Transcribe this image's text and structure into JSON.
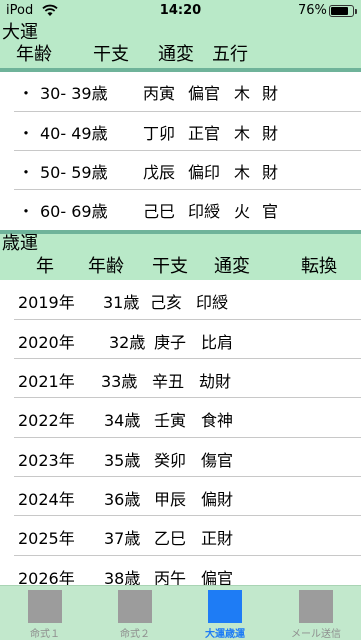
{
  "status_bar": {
    "carrier": "iPod",
    "time": "14:20",
    "battery": "76%",
    "battery_level": 0.76
  },
  "daiun": {
    "title": "大運",
    "headers": {
      "age": "年齢",
      "kanshi": "干支",
      "tsuhen": "通変",
      "gogyo": "五行"
    },
    "rows": [
      {
        "bullet": "・",
        "age": "30- 39歳",
        "kanshi": "丙寅",
        "tsuhen": "偏官",
        "gogyo": "木",
        "extra": "財"
      },
      {
        "bullet": "・",
        "age": "40- 49歳",
        "kanshi": "丁卯",
        "tsuhen": "正官",
        "gogyo": "木",
        "extra": "財"
      },
      {
        "bullet": "・",
        "age": "50- 59歳",
        "kanshi": "戊辰",
        "tsuhen": "偏印",
        "gogyo": "木",
        "extra": "財"
      },
      {
        "bullet": "・",
        "age": "60- 69歳",
        "kanshi": "己巳",
        "tsuhen": "印綬",
        "gogyo": "火",
        "extra": "官"
      }
    ]
  },
  "saiun": {
    "title": "歳運",
    "headers": {
      "year": "年",
      "age": "年齢",
      "kanshi": "干支",
      "tsuhen": "通変",
      "tenkan": "転換"
    },
    "rows": [
      {
        "year": "2019年",
        "age": "31歳",
        "kanshi": "己亥",
        "tsuhen": "印綬"
      },
      {
        "year": "2020年",
        "age": "32歳",
        "kanshi": "庚子",
        "tsuhen": "比肩"
      },
      {
        "year": "2021年",
        "age": "33歳",
        "kanshi": "辛丑",
        "tsuhen": "劫財"
      },
      {
        "year": "2022年",
        "age": "34歳",
        "kanshi": "壬寅",
        "tsuhen": "食神"
      },
      {
        "year": "2023年",
        "age": "35歳",
        "kanshi": "癸卯",
        "tsuhen": "傷官"
      },
      {
        "year": "2024年",
        "age": "36歳",
        "kanshi": "甲辰",
        "tsuhen": "偏財"
      },
      {
        "year": "2025年",
        "age": "37歳",
        "kanshi": "乙巳",
        "tsuhen": "正財"
      },
      {
        "year": "2026年",
        "age": "38歳",
        "kanshi": "丙午",
        "tsuhen": "偏官"
      }
    ]
  },
  "tabs": [
    {
      "label": "命式１",
      "active": false
    },
    {
      "label": "命式２",
      "active": false
    },
    {
      "label": "大運歳運",
      "active": true
    },
    {
      "label": "メール送信",
      "active": false
    }
  ],
  "colors": {
    "header_bg": "#b9e9c8",
    "header_bar": "#6fb39a",
    "tab_active": "#1e7cf5",
    "tab_inactive": "#9c9c9c"
  }
}
